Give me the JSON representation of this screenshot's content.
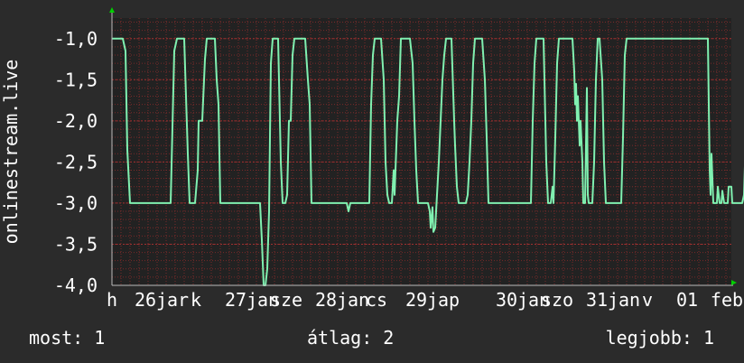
{
  "chart_data": {
    "type": "line",
    "ylabel": "onlinestream.live",
    "ylim": [
      -4.0,
      -0.75
    ],
    "yticks": [
      "-1,0",
      "-1,5",
      "-2,0",
      "-2,5",
      "-3,0",
      "-3,5",
      "-4,0"
    ],
    "ytick_values": [
      -1.0,
      -1.5,
      -2.0,
      -2.5,
      -3.0,
      -3.5,
      -4.0
    ],
    "xlim": [
      0,
      8
    ],
    "xticks": [
      "h",
      "26",
      "jar",
      "k",
      "27",
      "jan",
      "sze",
      "28",
      "jan",
      "cs",
      "29",
      "jap",
      "30",
      "jan",
      "szo",
      "31",
      "jan",
      "v",
      "01",
      "febr"
    ],
    "xtick_positions": [
      0.0,
      0.37,
      0.67,
      0.93,
      1.37,
      1.67,
      1.93,
      2.37,
      2.67,
      2.93,
      3.37,
      3.67,
      4.37,
      4.67,
      4.93,
      5.37,
      5.67,
      5.93,
      6.37,
      6.87
    ],
    "grid": true,
    "colors": {
      "background": "#2b2b2b",
      "plot_background": "#222222",
      "line": "#80f0b0",
      "grid": "#7a2a2a",
      "axis_text": "#ffffff",
      "arrow": "#00d000"
    },
    "series": [
      {
        "values": [
          [
            0.0,
            -1.0
          ],
          [
            0.12,
            -1.0
          ],
          [
            0.15,
            -1.15
          ],
          [
            0.17,
            -2.35
          ],
          [
            0.2,
            -3.0
          ],
          [
            0.3,
            -3.0
          ],
          [
            0.5,
            -3.0
          ],
          [
            0.6,
            -3.0
          ],
          [
            0.65,
            -3.0
          ],
          [
            0.69,
            -1.15
          ],
          [
            0.72,
            -1.0
          ],
          [
            0.8,
            -1.0
          ],
          [
            0.84,
            -2.4
          ],
          [
            0.86,
            -3.0
          ],
          [
            0.92,
            -3.0
          ],
          [
            0.95,
            -2.6
          ],
          [
            0.96,
            -2.0
          ],
          [
            1.0,
            -2.0
          ],
          [
            1.03,
            -1.25
          ],
          [
            1.05,
            -1.0
          ],
          [
            1.14,
            -1.0
          ],
          [
            1.16,
            -1.5
          ],
          [
            1.18,
            -1.8
          ],
          [
            1.2,
            -3.0
          ],
          [
            1.4,
            -3.0
          ],
          [
            1.6,
            -3.0
          ],
          [
            1.64,
            -3.0
          ],
          [
            1.66,
            -3.45
          ],
          [
            1.68,
            -4.0
          ],
          [
            1.7,
            -4.0
          ],
          [
            1.72,
            -3.8
          ],
          [
            1.74,
            -3.1
          ],
          [
            1.76,
            -1.3
          ],
          [
            1.78,
            -1.0
          ],
          [
            1.84,
            -1.0
          ],
          [
            1.87,
            -2.5
          ],
          [
            1.89,
            -3.0
          ],
          [
            1.92,
            -3.0
          ],
          [
            1.94,
            -2.9
          ],
          [
            1.96,
            -2.0
          ],
          [
            1.98,
            -2.0
          ],
          [
            2.0,
            -1.2
          ],
          [
            2.02,
            -1.0
          ],
          [
            2.14,
            -1.0
          ],
          [
            2.17,
            -1.5
          ],
          [
            2.19,
            -1.8
          ],
          [
            2.21,
            -3.0
          ],
          [
            2.6,
            -3.0
          ],
          [
            2.62,
            -3.1
          ],
          [
            2.64,
            -3.0
          ],
          [
            2.85,
            -3.0
          ],
          [
            2.87,
            -1.8
          ],
          [
            2.89,
            -1.2
          ],
          [
            2.91,
            -1.0
          ],
          [
            2.98,
            -1.0
          ],
          [
            3.01,
            -1.5
          ],
          [
            3.03,
            -2.5
          ],
          [
            3.05,
            -2.9
          ],
          [
            3.07,
            -3.0
          ],
          [
            3.1,
            -3.0
          ],
          [
            3.12,
            -2.6
          ],
          [
            3.13,
            -2.9
          ],
          [
            3.15,
            -2.3
          ],
          [
            3.16,
            -2.0
          ],
          [
            3.18,
            -1.7
          ],
          [
            3.2,
            -1.0
          ],
          [
            3.3,
            -1.0
          ],
          [
            3.33,
            -1.3
          ],
          [
            3.35,
            -2.0
          ],
          [
            3.37,
            -2.6
          ],
          [
            3.39,
            -3.0
          ],
          [
            3.45,
            -3.0
          ],
          [
            3.5,
            -3.0
          ],
          [
            3.52,
            -3.1
          ],
          [
            3.53,
            -3.3
          ],
          [
            3.55,
            -3.05
          ],
          [
            3.56,
            -3.35
          ],
          [
            3.58,
            -3.3
          ],
          [
            3.6,
            -2.9
          ],
          [
            3.62,
            -2.5
          ],
          [
            3.64,
            -2.0
          ],
          [
            3.66,
            -1.5
          ],
          [
            3.68,
            -1.2
          ],
          [
            3.7,
            -1.0
          ],
          [
            3.76,
            -1.0
          ],
          [
            3.79,
            -2.0
          ],
          [
            3.8,
            -2.3
          ],
          [
            3.82,
            -2.8
          ],
          [
            3.84,
            -3.0
          ],
          [
            3.92,
            -3.0
          ],
          [
            3.94,
            -2.9
          ],
          [
            3.96,
            -2.5
          ],
          [
            3.98,
            -2.0
          ],
          [
            4.0,
            -1.3
          ],
          [
            4.02,
            -1.0
          ],
          [
            4.1,
            -1.0
          ],
          [
            4.13,
            -1.5
          ],
          [
            4.15,
            -2.2
          ],
          [
            4.17,
            -3.0
          ],
          [
            4.28,
            -3.0
          ],
          [
            4.4,
            -3.0
          ],
          [
            4.6,
            -3.0
          ],
          [
            4.64,
            -3.0
          ],
          [
            4.66,
            -2.0
          ],
          [
            4.68,
            -1.3
          ],
          [
            4.7,
            -1.0
          ],
          [
            4.78,
            -1.0
          ],
          [
            4.81,
            -2.5
          ],
          [
            4.83,
            -3.0
          ],
          [
            4.86,
            -3.0
          ],
          [
            4.88,
            -2.8
          ],
          [
            4.89,
            -3.0
          ],
          [
            4.91,
            -2.2
          ],
          [
            4.93,
            -1.3
          ],
          [
            4.95,
            -1.0
          ],
          [
            5.1,
            -1.0
          ],
          [
            5.12,
            -1.4
          ],
          [
            5.13,
            -1.8
          ],
          [
            5.14,
            -1.55
          ],
          [
            5.15,
            -2.0
          ],
          [
            5.16,
            -1.7
          ],
          [
            5.18,
            -2.3
          ],
          [
            5.19,
            -2.0
          ],
          [
            5.21,
            -2.5
          ],
          [
            5.22,
            -3.0
          ],
          [
            5.24,
            -3.0
          ],
          [
            5.26,
            -1.6
          ],
          [
            5.27,
            -2.9
          ],
          [
            5.28,
            -3.0
          ],
          [
            5.32,
            -3.0
          ],
          [
            5.34,
            -2.5
          ],
          [
            5.36,
            -1.5
          ],
          [
            5.38,
            -1.0
          ],
          [
            5.4,
            -1.0
          ],
          [
            5.43,
            -1.5
          ],
          [
            5.45,
            -2.5
          ],
          [
            5.47,
            -3.0
          ],
          [
            5.6,
            -3.0
          ],
          [
            5.64,
            -3.0
          ],
          [
            5.66,
            -2.2
          ],
          [
            5.68,
            -1.2
          ],
          [
            5.7,
            -1.0
          ],
          [
            6.0,
            -1.0
          ],
          [
            6.05,
            -1.0
          ],
          [
            6.15,
            -1.0
          ],
          [
            6.3,
            -1.0
          ],
          [
            6.5,
            -1.0
          ],
          [
            6.6,
            -1.0
          ],
          [
            6.62,
            -2.6
          ],
          [
            6.63,
            -2.9
          ],
          [
            6.64,
            -2.4
          ],
          [
            6.66,
            -3.0
          ],
          [
            6.7,
            -3.0
          ],
          [
            6.71,
            -2.8
          ],
          [
            6.73,
            -3.0
          ],
          [
            6.75,
            -3.0
          ],
          [
            6.76,
            -2.85
          ],
          [
            6.78,
            -3.0
          ],
          [
            6.82,
            -3.0
          ],
          [
            6.83,
            -2.8
          ],
          [
            6.86,
            -2.8
          ],
          [
            6.87,
            -3.0
          ],
          [
            6.98,
            -3.0
          ],
          [
            7.0,
            -2.9
          ],
          [
            7.02,
            -2.2
          ],
          [
            7.04,
            -1.2
          ],
          [
            7.06,
            -1.0
          ],
          [
            7.1,
            -1.0
          ]
        ]
      }
    ]
  },
  "stats": {
    "most": "most: 1",
    "avg": "átlag: 2",
    "max": "legjobb: 1"
  }
}
